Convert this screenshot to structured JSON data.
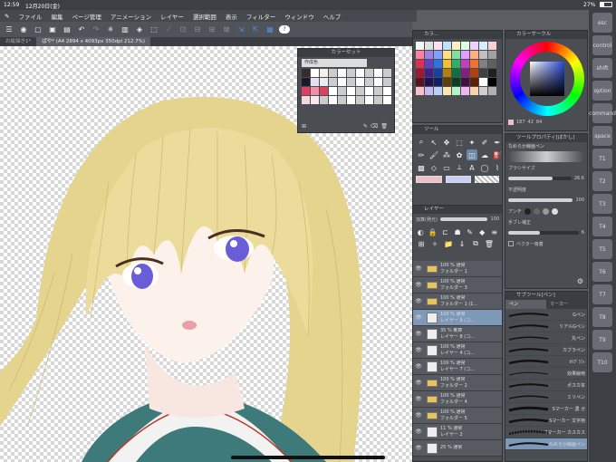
{
  "status": {
    "time": "12:59",
    "date": "12月20日(金)",
    "battery": "27%"
  },
  "menu": [
    "ファイル",
    "編集",
    "ページ管理",
    "アニメーション",
    "レイヤー",
    "選択範囲",
    "表示",
    "フィルター",
    "ウィンドウ",
    "ヘルプ"
  ],
  "tabs": [
    {
      "label": "お絵描き1*"
    },
    {
      "label": "ぱや* (A4 2894 x 4093px 350dpi 212.7%)"
    }
  ],
  "color_set": {
    "title": "カラーセット",
    "preset": "作成色"
  },
  "color_panel_title": "カラ…",
  "color_circle": {
    "title": "カラーサークル",
    "h": "187",
    "s": "42",
    "v": "84"
  },
  "tool_panel_title": "ツール",
  "tool_property": {
    "title": "ツールプロパティ[ぼかし]",
    "brush_name": "なめらか線画ペン",
    "brush_size_label": "ブラシサイズ",
    "brush_size": "26.6",
    "opacity_label": "不透明度",
    "opacity": "100",
    "antialias_label": "アンチ",
    "stabilization_label": "手ブレ補正",
    "stabilization": "6",
    "vector_label": "ベクター吸着"
  },
  "layers": {
    "title": "レイヤー",
    "blend": "加算(発光)",
    "opacity": "100",
    "items": [
      {
        "line1": "100 % 通常",
        "line2": "フォルダー 1",
        "type": "folder"
      },
      {
        "line1": "100 % 通常",
        "line2": "フォルダー 3",
        "type": "folder"
      },
      {
        "line1": "100 % 通常",
        "line2": "フォルダー 1 (1…",
        "type": "folder"
      },
      {
        "line1": "100 % 通常",
        "line2": "レイヤー 9 (コ…",
        "type": "layer",
        "selected": true
      },
      {
        "line1": "35 % 乗算",
        "line2": "レイヤー 8 (コ…",
        "type": "layer"
      },
      {
        "line1": "100 % 通常",
        "line2": "レイヤー 4 (コ…",
        "type": "layer"
      },
      {
        "line1": "100 % 通常",
        "line2": "レイヤー 7 (コ…",
        "type": "layer"
      },
      {
        "line1": "100 % 通常",
        "line2": "フォルダー 2",
        "type": "folder"
      },
      {
        "line1": "100 % 通常",
        "line2": "フォルダー 4",
        "type": "folder"
      },
      {
        "line1": "100 % 通常",
        "line2": "フォルダー 5",
        "type": "folder"
      },
      {
        "line1": "11 % 通常",
        "line2": "レイヤー 2",
        "type": "layer"
      },
      {
        "line1": "25 % 通常",
        "line2": "",
        "type": "layer"
      }
    ]
  },
  "subtool": {
    "title": "サブツール[ペン]",
    "tabs": [
      "ペン",
      "マーカー"
    ],
    "brushes": [
      "Gペン",
      "リアルGペン",
      "丸ペン",
      "カブラペン",
      "ｶﾘｸﾞﾗﾌｨ",
      "効果線用",
      "ポスカ本",
      "ミリペン",
      "Sマーカー 濃 ガ",
      "Sマーカー 文字用",
      "Sマーカー カスカス",
      "なめらか線画ペン"
    ]
  },
  "side_keys": [
    {
      "label": "esc"
    },
    {
      "label": "control"
    },
    {
      "label": "shift"
    },
    {
      "label": "option"
    },
    {
      "label": "command"
    },
    {
      "label": "space"
    },
    {
      "label": "T1"
    },
    {
      "label": "T2"
    },
    {
      "label": "T3"
    },
    {
      "label": "T4"
    },
    {
      "label": "T5"
    },
    {
      "label": "T6"
    },
    {
      "label": "T7"
    },
    {
      "label": "T8"
    },
    {
      "label": "T9"
    },
    {
      "label": "T10"
    }
  ],
  "colors": {
    "accent": "#7e98b8",
    "hair": "#e8d898",
    "eye": "#6a5ed8"
  }
}
